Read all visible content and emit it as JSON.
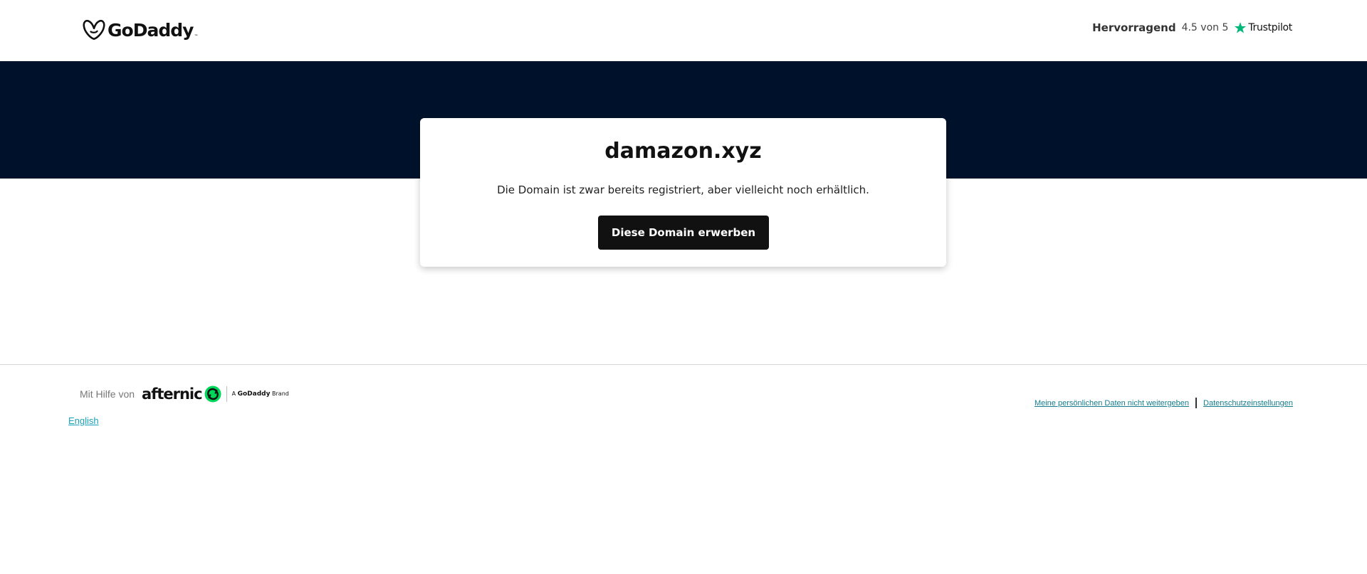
{
  "header": {
    "logo_text": "GoDaddy",
    "logo_tm": "™",
    "rating": {
      "label": "Hervorragend",
      "score": "4.5 von 5",
      "brand": "Trustpilot",
      "star_color": "#00b67a"
    }
  },
  "hero": {
    "band_color": "#00122b"
  },
  "card": {
    "domain": "damazon.xyz",
    "subtitle": "Die Domain ist zwar bereits registriert, aber vielleicht noch erhältlich.",
    "cta_label": "Diese Domain erwerben"
  },
  "footer": {
    "powered_label": "Mit Hilfe von",
    "afternic_text": "afternic",
    "afternic_color": "#00d65a",
    "brand_tag_prefix": "A",
    "brand_tag_name": "GoDaddy",
    "brand_tag_suffix": "Brand",
    "language_link": "English",
    "legal_links": [
      "Meine persönlichen Daten nicht weitergeben",
      "Datenschutzeinstellungen"
    ]
  }
}
